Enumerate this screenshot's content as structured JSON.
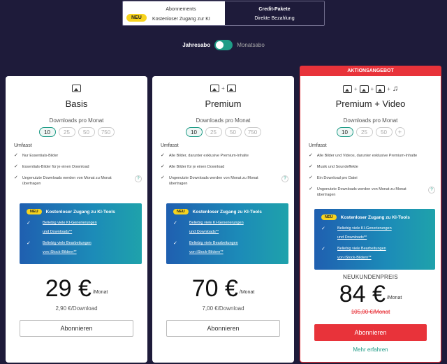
{
  "tabs": {
    "abo": {
      "badge": "NEU",
      "title": "Abonnements",
      "subtitle": "Kostenloser Zugang zur KI"
    },
    "credit": {
      "title": "Credit-Pakete",
      "subtitle": "Direkte Bezahlung"
    }
  },
  "billing": {
    "yearly": "Jahresabo",
    "monthly": "Monatsabo"
  },
  "promo_banner": "AKTIONSANGEBOT",
  "common": {
    "downloads_label": "Downloads pro Monat",
    "umfasst": "Umfasst",
    "button": "Abonnieren",
    "per_month": "/Monat",
    "help": "?",
    "check": "✓",
    "plus": "+"
  },
  "ai_box": {
    "badge": "NEU",
    "title": "Kostenloser Zugang zu KI-Tools",
    "item1_line1": "Beliebig viele KI-Generierungen",
    "item1_line2": "und Downloads**",
    "item2_line1": "Beliebig viele Bearbeitungen",
    "item2_line2": "von iStock-Bildern**"
  },
  "plans": [
    {
      "name": "Basis",
      "quantities": [
        "10",
        "25",
        "50",
        "750"
      ],
      "features": [
        "Nur Essentials-Bilder",
        "Essentials-Bilder für je einen Download",
        "Ungenutzte Downloads werden von Monat zu Monat übertragen"
      ],
      "price": "29 €",
      "per_download": "2,90 €/Download"
    },
    {
      "name": "Premium",
      "quantities": [
        "10",
        "25",
        "50",
        "750"
      ],
      "features": [
        "Alle Bilder, darunter exklusive Premium-Inhalte",
        "Alle Bilder für je einen Download",
        "Ungenutzte Downloads werden von Monat zu Monat übertragen"
      ],
      "price": "70 €",
      "per_download": "7,00 €/Download"
    },
    {
      "name": "Premium + Video",
      "quantities": [
        "10",
        "25",
        "50"
      ],
      "features": [
        "Alle Bilder und Videos, darunter exklusive Premium-Inhalte",
        "Musik und Soundeffekte",
        "Ein Download pro Datei",
        "Ungenutzte Downloads werden von Monat zu Monat übertragen"
      ],
      "price_label": "NEUKUNDENPREIS",
      "price": "84 €",
      "old_price": "105,00 €/Monat",
      "more_link": "Mehr erfahren"
    }
  ],
  "colors": {
    "background": "#1e1b3a",
    "accent": "#1f9c87",
    "promo": "#e8333a",
    "badge": "#f7d31e"
  }
}
